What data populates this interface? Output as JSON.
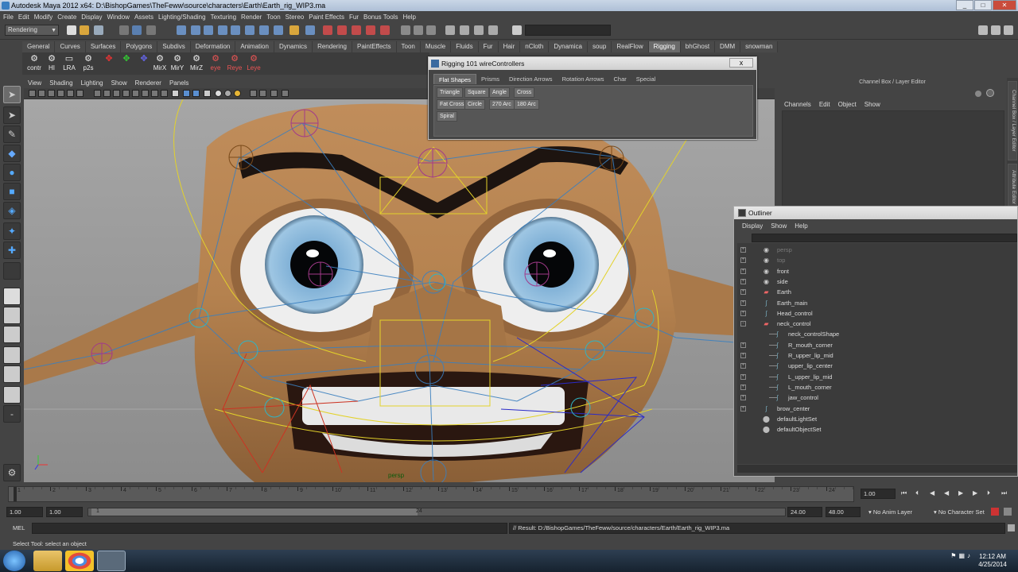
{
  "window": {
    "title": "Autodesk Maya 2012 x64: D:\\BishopGames\\TheFeww\\source\\characters\\Earth\\Earth_rig_WIP3.ma"
  },
  "menubar": [
    "File",
    "Edit",
    "Modify",
    "Create",
    "Display",
    "Window",
    "Assets",
    "Lighting/Shading",
    "Texturing",
    "Render",
    "Toon",
    "Stereo",
    "Paint Effects",
    "Fur",
    "Bonus Tools",
    "Help"
  ],
  "statusline": {
    "mode": "Rendering"
  },
  "shelf": {
    "tabs": [
      "General",
      "Curves",
      "Surfaces",
      "Polygons",
      "Subdivs",
      "Deformation",
      "Animation",
      "Dynamics",
      "Rendering",
      "PaintEffects",
      "Toon",
      "Muscle",
      "Fluids",
      "Fur",
      "Hair",
      "nCloth",
      "Dynamica",
      "soup",
      "RealFlow",
      "Rigging",
      "bhGhost",
      "DMM",
      "snowman"
    ],
    "active_tab": "Rigging",
    "buttons": [
      "contr",
      "HI",
      "LRA",
      "p2s",
      "",
      "",
      "",
      "MirX",
      "MirY",
      "MirZ",
      "eye",
      "Reye",
      "Leye"
    ]
  },
  "panel": {
    "menus": [
      "View",
      "Shading",
      "Lighting",
      "Show",
      "Renderer",
      "Panels"
    ],
    "camera_label": "persp"
  },
  "rigging_window": {
    "title": "Rigging 101 wireControllers",
    "close": "x",
    "tabs": [
      "Flat Shapes",
      "Prisms",
      "Direction Arrows",
      "Rotation Arrows",
      "Char",
      "Special"
    ],
    "active_tab": "Flat Shapes",
    "buttons": [
      "Triangle",
      "Square",
      "Angle",
      "Cross",
      "Fat Cross",
      "Circle",
      "270 Arc",
      "180 Arc",
      "Spiral"
    ]
  },
  "channel_box": {
    "title": "Channel Box / Layer Editor",
    "menus": [
      "Channels",
      "Edit",
      "Object",
      "Show"
    ],
    "side_tabs": [
      "Channel Box / Layer Editor",
      "Attribute Editor"
    ]
  },
  "outliner": {
    "title": "Outliner",
    "menus": [
      "Display",
      "Show",
      "Help"
    ],
    "items": [
      {
        "name": "persp",
        "depth": 0,
        "expander": "+",
        "icon": "camera-icon",
        "dim": true
      },
      {
        "name": "top",
        "depth": 0,
        "expander": "+",
        "icon": "camera-icon",
        "dim": true
      },
      {
        "name": "front",
        "depth": 0,
        "expander": "+",
        "icon": "camera-icon",
        "dim": false
      },
      {
        "name": "side",
        "depth": 0,
        "expander": "+",
        "icon": "camera-icon",
        "dim": false
      },
      {
        "name": "Earth",
        "depth": 0,
        "expander": "+",
        "icon": "mesh-icon",
        "dim": false
      },
      {
        "name": "Earth_main",
        "depth": 0,
        "expander": "+",
        "icon": "curve-icon",
        "dim": false
      },
      {
        "name": "Head_control",
        "depth": 0,
        "expander": "+",
        "icon": "curve-icon",
        "dim": false
      },
      {
        "name": "neck_control",
        "depth": 0,
        "expander": "-",
        "icon": "mesh-icon",
        "dim": false
      },
      {
        "name": "neck_controlShape",
        "depth": 1,
        "expander": "",
        "icon": "curve-icon",
        "dim": false
      },
      {
        "name": "R_mouth_corner",
        "depth": 1,
        "expander": "+",
        "icon": "curve-icon",
        "dim": false
      },
      {
        "name": "R_upper_lip_mid",
        "depth": 1,
        "expander": "+",
        "icon": "curve-icon",
        "dim": false
      },
      {
        "name": "upper_lip_center",
        "depth": 1,
        "expander": "+",
        "icon": "curve-icon",
        "dim": false
      },
      {
        "name": "L_upper_lip_mid",
        "depth": 1,
        "expander": "+",
        "icon": "curve-icon",
        "dim": false
      },
      {
        "name": "L_mouth_corner",
        "depth": 1,
        "expander": "+",
        "icon": "curve-icon",
        "dim": false
      },
      {
        "name": "jaw_control",
        "depth": 1,
        "expander": "+",
        "icon": "curve-icon",
        "dim": false
      },
      {
        "name": "brow_center",
        "depth": 0,
        "expander": "+",
        "icon": "curve-icon",
        "dim": false
      },
      {
        "name": "defaultLightSet",
        "depth": 0,
        "expander": "",
        "icon": "set-icon",
        "dim": false
      },
      {
        "name": "defaultObjectSet",
        "depth": 0,
        "expander": "",
        "icon": "set-icon",
        "dim": false
      }
    ]
  },
  "timeslider": {
    "ticks": [
      "1",
      "2",
      "3",
      "4",
      "5",
      "6",
      "7",
      "8",
      "9",
      "10",
      "11",
      "12",
      "13",
      "14",
      "15",
      "16",
      "17",
      "18",
      "19",
      "20",
      "21",
      "22",
      "23",
      "24"
    ],
    "current_frame": "1.00"
  },
  "range": {
    "start": "1.00",
    "playback_start": "1.00",
    "bar_start": "1",
    "bar_end": "24",
    "playback_end": "24.00",
    "end": "48.00",
    "anim_layer": "No Anim Layer",
    "character_set": "No Character Set"
  },
  "mel": {
    "label": "MEL",
    "result": "// Result: D:/BishopGames/TheFeww/source/characters/Earth/Earth_rig_WIP3.ma"
  },
  "help_line": "Select Tool: select an object",
  "taskbar": {
    "time": "12:12 AM",
    "date": "4/25/2014"
  },
  "colors": {
    "accent_active_tab": "#6a6a6a",
    "viewport_bg": "#9a9a9a",
    "skin": "#b88755",
    "wire_blue": "#3a7fbf",
    "wire_yellow": "#e3d22a"
  }
}
